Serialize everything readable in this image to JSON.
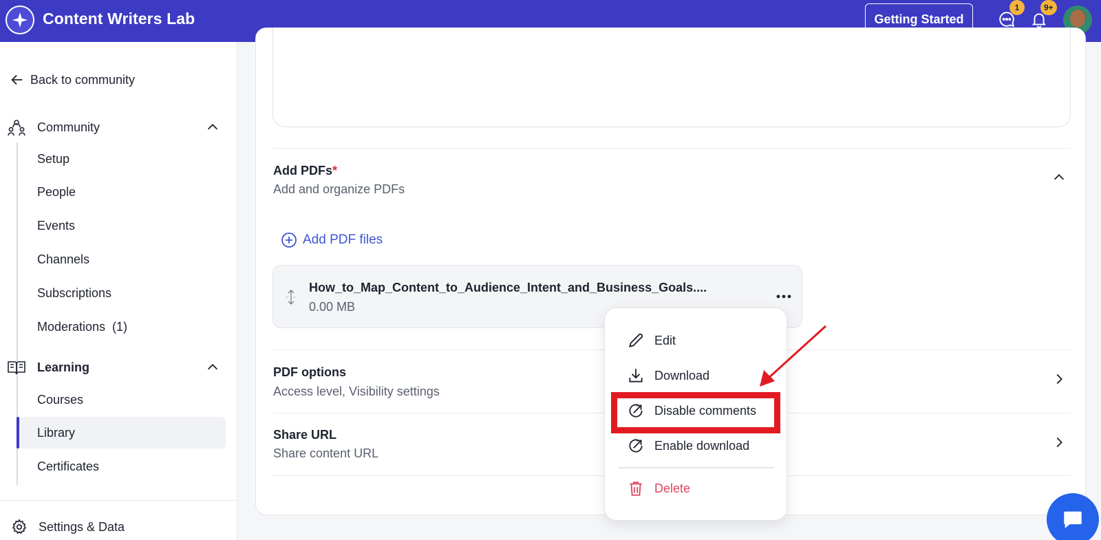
{
  "header": {
    "app_title": "Content Writers Lab",
    "getting_started": "Getting Started",
    "messages_badge": "1",
    "notifications_badge": "9+",
    "accent": "#3d3ac4"
  },
  "sidebar": {
    "back": "Back to community",
    "community": {
      "label": "Community",
      "items": [
        "Setup",
        "People",
        "Events",
        "Channels",
        "Subscriptions",
        "Moderations  (1)"
      ]
    },
    "learning": {
      "label": "Learning",
      "items": [
        "Courses",
        "Library",
        "Certificates"
      ],
      "active": "Library"
    },
    "settings": "Settings & Data"
  },
  "main": {
    "add_pdfs": {
      "title": "Add PDFs",
      "required_mark": "*",
      "subtitle": "Add and organize PDFs",
      "add_button": "Add PDF files"
    },
    "file": {
      "name": "How_to_Map_Content_to_Audience_Intent_and_Business_Goals....",
      "size": "0.00 MB"
    },
    "pdf_options": {
      "title": "PDF options",
      "subtitle": "Access level, Visibility settings"
    },
    "share_url": {
      "title": "Share URL",
      "subtitle": "Share content URL"
    }
  },
  "menu": {
    "edit": "Edit",
    "download": "Download",
    "disable_comments": "Disable comments",
    "enable_download": "Enable download",
    "delete": "Delete",
    "highlight_color": "#e21b23",
    "danger_color": "#e0445c"
  }
}
